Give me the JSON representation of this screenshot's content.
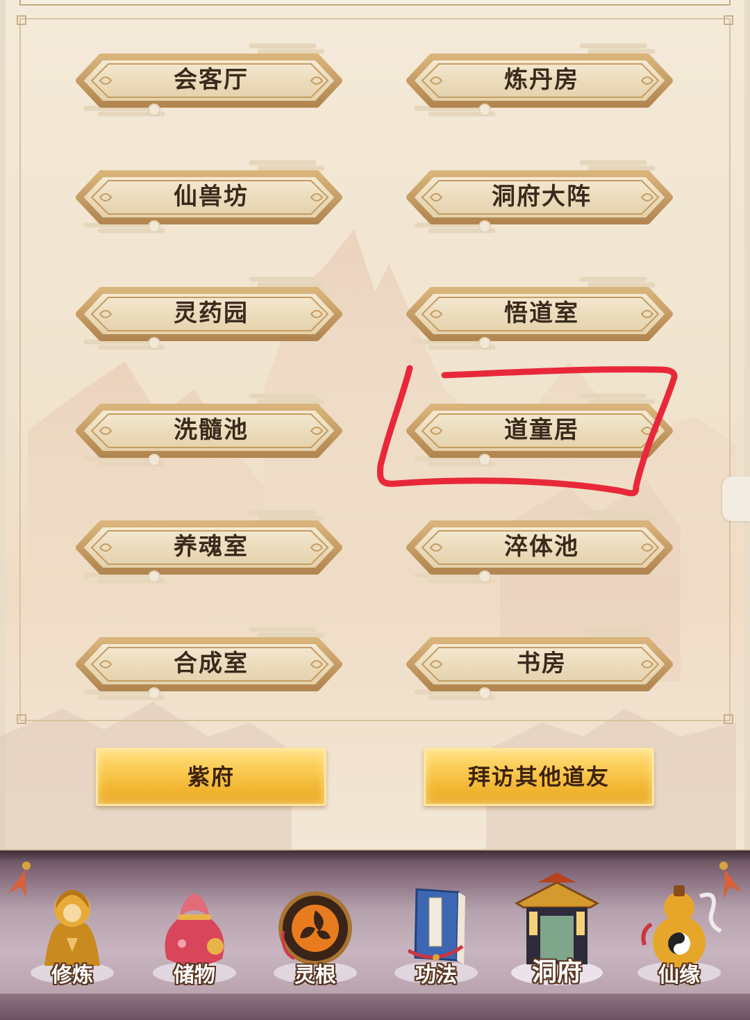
{
  "buildings": [
    {
      "label": "会客厅"
    },
    {
      "label": "炼丹房"
    },
    {
      "label": "仙兽坊"
    },
    {
      "label": "洞府大阵"
    },
    {
      "label": "灵药园"
    },
    {
      "label": "悟道室"
    },
    {
      "label": "洗髓池"
    },
    {
      "label": "道童居"
    },
    {
      "label": "养魂室"
    },
    {
      "label": "淬体池"
    },
    {
      "label": "合成室"
    },
    {
      "label": "书房"
    }
  ],
  "actions": {
    "purple_mansion": "紫府",
    "visit_friends": "拜访其他道友"
  },
  "bottom_nav": [
    {
      "label": "修炼",
      "icon": "meditating-monk-icon"
    },
    {
      "label": "储物",
      "icon": "storage-pouch-icon"
    },
    {
      "label": "灵根",
      "icon": "spirit-root-orb-icon"
    },
    {
      "label": "功法",
      "icon": "scripture-book-icon"
    },
    {
      "label": "洞府",
      "icon": "cave-mansion-icon",
      "active": true
    },
    {
      "label": "仙缘",
      "icon": "gourd-icon"
    }
  ],
  "colors": {
    "panel": "#f2e6d3",
    "button_text": "#3a2a1c",
    "gold_button": "#f6c245",
    "nav_bar": "#b6a2ae",
    "annotation": "#e8283a"
  }
}
